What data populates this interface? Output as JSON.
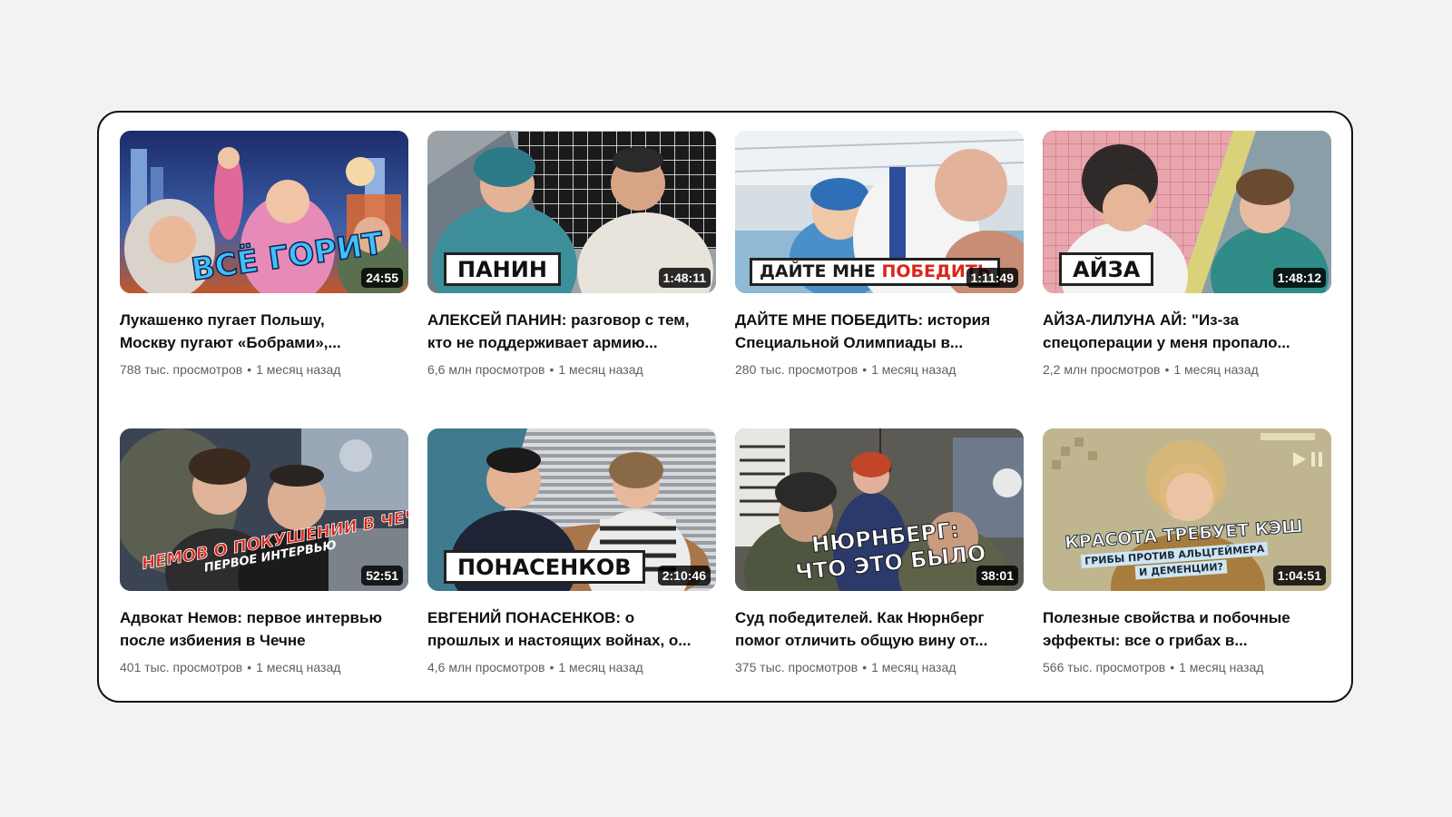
{
  "videos": [
    {
      "title_line1": "Лукашенко пугает Польшу,",
      "title_line2": "Москву пугают «Бобрами»,...",
      "views": "788 тыс. просмотров",
      "age": "1 месяц назад",
      "duration": "24:55",
      "overlay": "ВСЁ ГОРИТ"
    },
    {
      "title_line1": "АЛЕКСЕЙ ПАНИН: разговор с тем,",
      "title_line2": "кто не поддерживает армию...",
      "views": "6,6 млн просмотров",
      "age": "1 месяц назад",
      "duration": "1:48:11",
      "overlay": "ПАНИН"
    },
    {
      "title_line1": "ДАЙТЕ МНЕ ПОБЕДИТЬ: история",
      "title_line2": "Специальной Олимпиады в...",
      "views": "280 тыс. просмотров",
      "age": "1 месяц назад",
      "duration": "1:11:49",
      "overlay_a": "ДАЙТЕ МНЕ ",
      "overlay_b": "ПОБЕДИТЬ"
    },
    {
      "title_line1": "АЙЗА-ЛИЛУНА АЙ: \"Из-за",
      "title_line2": "спецоперации у меня пропало...",
      "views": "2,2 млн просмотров",
      "age": "1 месяц назад",
      "duration": "1:48:12",
      "overlay": "АЙЗА"
    },
    {
      "title_line1": "Адвокат Немов: первое интервью",
      "title_line2": "после избиения в Чечне",
      "views": "401 тыс. просмотров",
      "age": "1 месяц назад",
      "duration": "52:51",
      "overlay_a": "НЕМОВ О ПОКУШЕНИИ В ЧЕЧНЕ",
      "overlay_b": "ПЕРВОЕ ИНТЕРВЬЮ"
    },
    {
      "title_line1": "ЕВГЕНИЙ ПОНАСЕНКОВ: о",
      "title_line2": "прошлых и настоящих войнах, о...",
      "views": "4,6 млн просмотров",
      "age": "1 месяц назад",
      "duration": "2:10:46",
      "overlay": "ПОНАСЕНКОВ"
    },
    {
      "title_line1": "Суд победителей. Как Нюрнберг",
      "title_line2": "помог отличить общую вину от...",
      "views": "375 тыс. просмотров",
      "age": "1 месяц назад",
      "duration": "38:01",
      "overlay_a": "НЮРНБЕРГ:",
      "overlay_b": "ЧТО ЭТО БЫЛО"
    },
    {
      "title_line1": "Полезные свойства и побочные",
      "title_line2": "эффекты: все о грибах в...",
      "views": "566 тыс. просмотров",
      "age": "1 месяц назад",
      "duration": "1:04:51",
      "overlay_a": "КРАСОТА ТРЕБУЕТ КЭШ",
      "overlay_b": "ГРИБЫ ПРОТИВ АЛЬЦГЕЙМЕРА",
      "overlay_c": "И ДЕМЕНЦИИ?"
    }
  ],
  "separator": "•",
  "colors": {
    "page_bg": "#f2f2f3",
    "panel_border": "#111111",
    "meta_text": "#606060",
    "title_text": "#0f0f0f",
    "overlay_blue": "#3ec0ff",
    "overlay_red": "#d8261c"
  }
}
